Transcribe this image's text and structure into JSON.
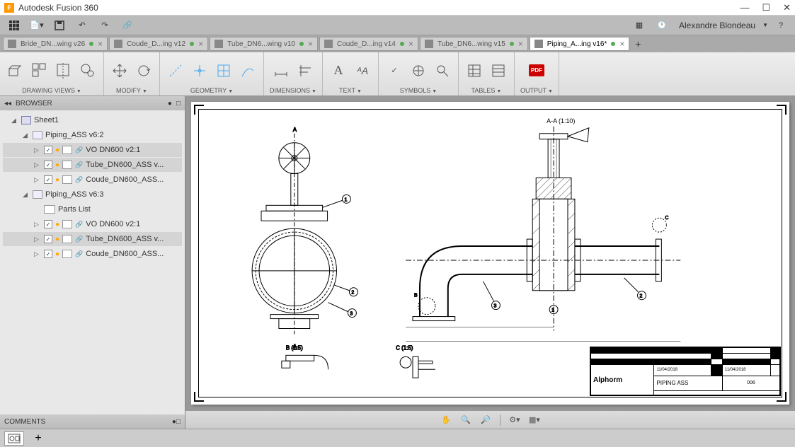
{
  "app": {
    "title": "Autodesk Fusion 360",
    "user": "Alexandre Blondeau"
  },
  "tabs": [
    {
      "label": "Bride_DN...wing v26",
      "active": false,
      "dirty": true
    },
    {
      "label": "Coude_D...ing v12",
      "active": false,
      "dirty": true
    },
    {
      "label": "Tube_DN6...wing v10",
      "active": false,
      "dirty": true
    },
    {
      "label": "Coude_D...ing v14",
      "active": false,
      "dirty": true
    },
    {
      "label": "Tube_DN6...wing v15",
      "active": false,
      "dirty": true
    },
    {
      "label": "Piping_A...ing v16*",
      "active": true,
      "dirty": true
    }
  ],
  "ribbon": {
    "drawing_views": "DRAWING VIEWS",
    "modify": "MODIFY",
    "geometry": "GEOMETRY",
    "dimensions": "DIMENSIONS",
    "text": "TEXT",
    "symbols": "SYMBOLS",
    "tables": "TABLES",
    "output": "OUTPUT"
  },
  "browser": {
    "title": "BROWSER",
    "comments": "COMMENTS",
    "tree": [
      {
        "depth": 1,
        "type": "sheet",
        "label": "Sheet1",
        "exp": "◢"
      },
      {
        "depth": 2,
        "type": "asm",
        "label": "Piping_ASS v6:2",
        "exp": "◢"
      },
      {
        "depth": 3,
        "type": "part",
        "label": "VO DN600 v2:1",
        "exp": "▷",
        "checked": true,
        "highlighted": true
      },
      {
        "depth": 3,
        "type": "part",
        "label": "Tube_DN600_ASS v...",
        "exp": "▷",
        "checked": true,
        "highlighted": true
      },
      {
        "depth": 3,
        "type": "part",
        "label": "Coude_DN600_ASS...",
        "exp": "▷",
        "checked": true
      },
      {
        "depth": 2,
        "type": "asm",
        "label": "Piping_ASS v6:3",
        "exp": "◢"
      },
      {
        "depth": 3,
        "type": "parts",
        "label": "Parts List"
      },
      {
        "depth": 3,
        "type": "part",
        "label": "VO DN600 v2:1",
        "exp": "▷",
        "checked": true
      },
      {
        "depth": 3,
        "type": "part",
        "label": "Tube_DN600_ASS v...",
        "exp": "▷",
        "checked": true,
        "highlighted": true
      },
      {
        "depth": 3,
        "type": "part",
        "label": "Coude_DN600_ASS...",
        "exp": "▷",
        "checked": true
      }
    ]
  },
  "drawing": {
    "section_aa": "A-A (1:10)",
    "view_a_top": "A",
    "view_a_bottom": "A",
    "view_b": "B (1:5)",
    "view_c": "C (1:5)",
    "titleblock": {
      "logo": "Alphorm",
      "part": "PIPING ASS",
      "sheet": "006",
      "date1": "11/04/2018",
      "date2": "11/04/2018"
    }
  }
}
